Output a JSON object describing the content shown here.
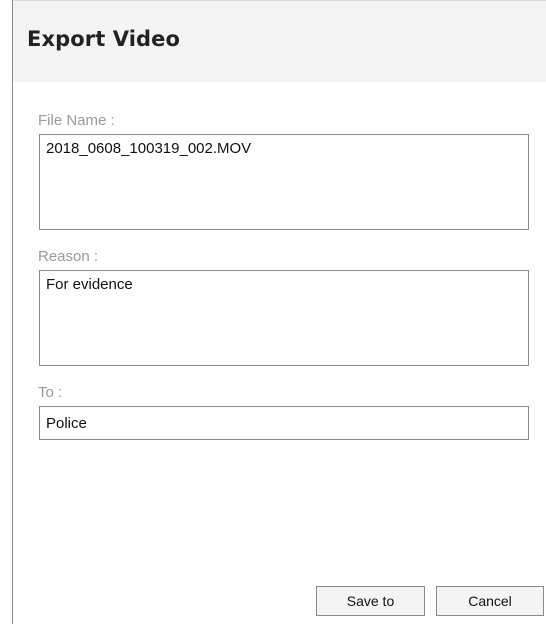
{
  "dialog": {
    "title": "Export Video"
  },
  "fields": {
    "file_name": {
      "label": "File Name :",
      "value": "2018_0608_100319_002.MOV"
    },
    "reason": {
      "label": "Reason :",
      "value": "For evidence"
    },
    "to": {
      "label": "To :",
      "value": "Police"
    }
  },
  "buttons": {
    "save_label": "Save to",
    "cancel_label": "Cancel"
  }
}
